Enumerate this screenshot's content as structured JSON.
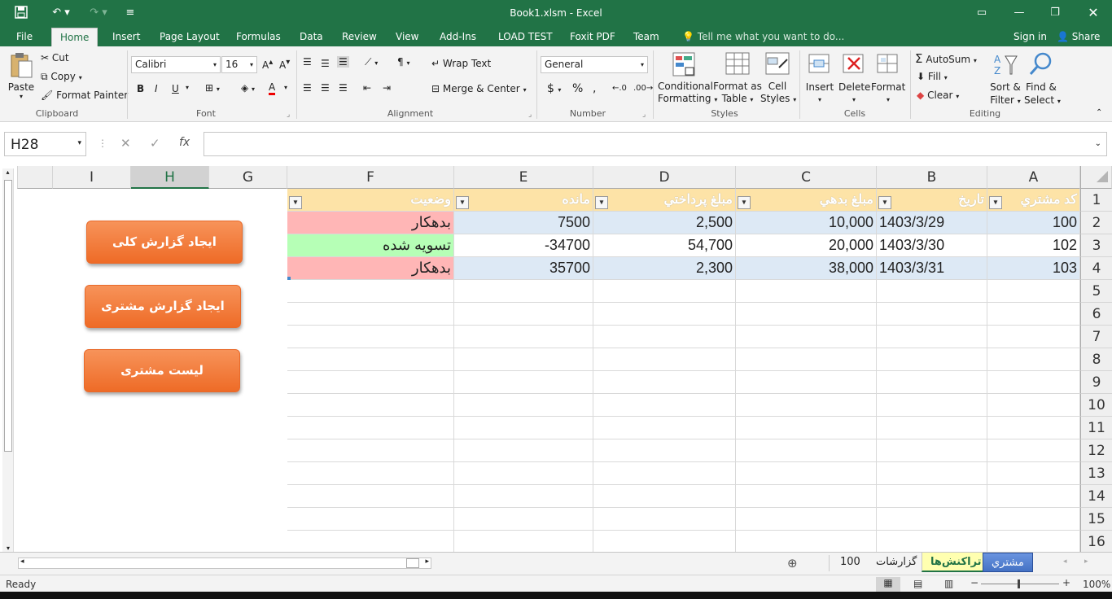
{
  "window": {
    "title": "Book1.xlsm - Excel"
  },
  "ribbon_tabs": [
    "File",
    "Home",
    "Insert",
    "Page Layout",
    "Formulas",
    "Data",
    "Review",
    "View",
    "Add-Ins",
    "LOAD TEST",
    "Foxit PDF",
    "Team"
  ],
  "tell_me": "Tell me what you want to do...",
  "account": {
    "signin": "Sign in",
    "share": "Share"
  },
  "clipboard": {
    "paste": "Paste",
    "cut": "Cut",
    "copy": "Copy",
    "format_painter": "Format Painter",
    "label": "Clipboard"
  },
  "font": {
    "name": "Calibri",
    "size": "16",
    "label": "Font",
    "bold": "B",
    "italic": "I",
    "underline": "U"
  },
  "alignment": {
    "wrap": "Wrap Text",
    "merge": "Merge & Center",
    "label": "Alignment"
  },
  "number": {
    "format": "General",
    "label": "Number"
  },
  "styles": {
    "conditional": "Conditional",
    "conditional2": "Formatting",
    "format_as": "Format as",
    "format_as2": "Table",
    "cell": "Cell",
    "cell2": "Styles",
    "label": "Styles"
  },
  "cells": {
    "insert": "Insert",
    "delete": "Delete",
    "format": "Format",
    "label": "Cells"
  },
  "editing": {
    "autosum": "AutoSum",
    "fill": "Fill",
    "clear": "Clear",
    "sort": "Sort &",
    "sort2": "Filter",
    "find": "Find &",
    "find2": "Select",
    "label": "Editing"
  },
  "namebox": "H28",
  "columns": [
    "I",
    "H",
    "G",
    "F",
    "E",
    "D",
    "C",
    "B",
    "A"
  ],
  "rows": [
    "1",
    "2",
    "3",
    "4",
    "5",
    "6",
    "7",
    "8",
    "9",
    "10",
    "11",
    "12",
    "13",
    "14",
    "15",
    "16"
  ],
  "table": {
    "headers": [
      "كد مشتري",
      "تاريخ",
      "مبلغ بدهي",
      "مبلغ پرداختي",
      "مانده",
      "وضعيت"
    ],
    "rows": [
      [
        "100",
        "1403/3/29",
        "10,000",
        "2,500",
        "7500",
        "بدهكار"
      ],
      [
        "102",
        "1403/3/30",
        "20,000",
        "54,700",
        "-34700",
        "تسويه شده"
      ],
      [
        "103",
        "1403/3/31",
        "38,000",
        "2,300",
        "35700",
        "بدهكار"
      ]
    ]
  },
  "buttons": [
    "ایجاد گزارش کلی",
    "ایجاد گزارش مشتری",
    "لیست مشتری"
  ],
  "sheets": [
    "مشتري",
    "تراكنش‌ها",
    "گزارشات",
    "100"
  ],
  "status": {
    "ready": "Ready",
    "zoom": "100%"
  },
  "colors": {
    "green": "#217346",
    "header": "#fde3a7",
    "debt": "#ffb6b6",
    "settled": "#b6ffb6",
    "row": "#dde9f5",
    "button": "#f07c3a"
  }
}
